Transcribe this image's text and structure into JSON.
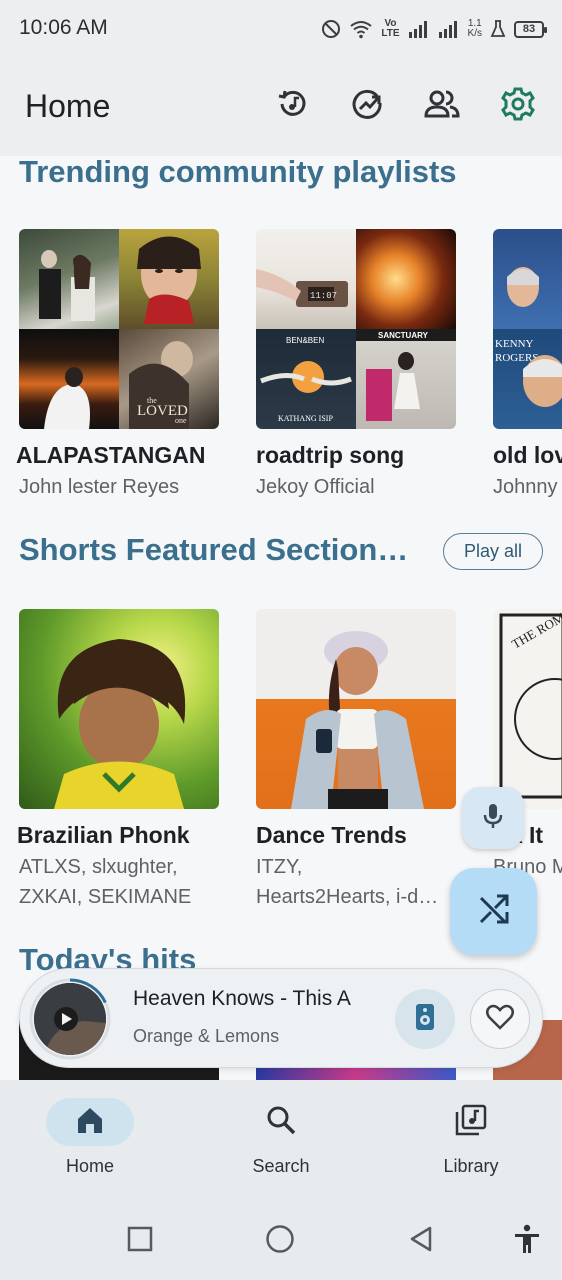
{
  "status_bar": {
    "time": "10:06 AM",
    "network_speed_top": "1.1",
    "network_speed_unit": "K/s",
    "volte_top": "Vo",
    "volte_bottom": "LTE",
    "battery": "83"
  },
  "header": {
    "title": "Home",
    "icons": [
      "history-icon",
      "trending-icon",
      "people-icon",
      "settings-icon"
    ],
    "accent_color": "#1f7a5e"
  },
  "sections": {
    "trending": {
      "title": "Trending community playlists",
      "cards": [
        {
          "title": "ALAPASTANGAN",
          "subtitle": "John lester Reyes"
        },
        {
          "title": "roadtrip song",
          "subtitle": "Jekoy Official"
        },
        {
          "title": "old lov",
          "subtitle": "Johnny"
        }
      ],
      "art_text": {
        "loved": "LOVED",
        "loved_small": "the",
        "loved_one": "one",
        "clock": "11:07",
        "benaben": "BEN&BEN",
        "kathang_isip": "KATHANG ISIP",
        "sanctuary": "SANCTUARY",
        "kenny": "KENNY",
        "rogers": "ROGERS"
      }
    },
    "shorts": {
      "title": "Shorts Featured Section…",
      "play_all": "Play all",
      "cards": [
        {
          "title": "Brazilian Phonk",
          "subtitle_line1": "ATLXS, slxughter,",
          "subtitle_line2": "ZXKAI, SEKIMANE"
        },
        {
          "title": "Dance Trends",
          "subtitle_line1": "ITZY,",
          "subtitle_line2": "Hearts2Hearts, i-d…"
        },
        {
          "title": "sk It",
          "subtitle_line1": "Bruno M",
          "art_text": "THE ROMANTIC"
        }
      ]
    },
    "todays_hits": {
      "title": "Today's hits"
    }
  },
  "mini_player": {
    "title": "Heaven Knows - This A",
    "artist": "Orange & Lemons",
    "progress": 0.18
  },
  "bottom_nav": {
    "items": [
      {
        "label": "Home",
        "icon": "home-icon",
        "active": true
      },
      {
        "label": "Search",
        "icon": "search-icon",
        "active": false
      },
      {
        "label": "Library",
        "icon": "library-icon",
        "active": false
      }
    ]
  },
  "system_nav": [
    "recents-icon",
    "home-circle-icon",
    "back-icon",
    "accessibility-icon"
  ]
}
